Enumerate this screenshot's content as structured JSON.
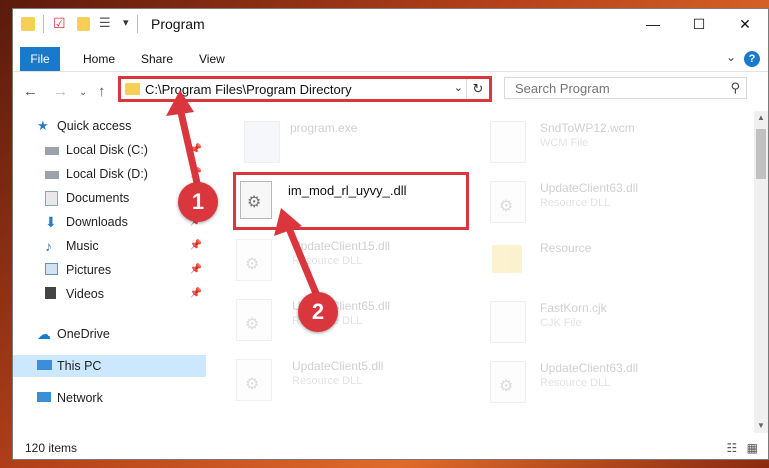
{
  "window": {
    "title": "Program"
  },
  "ribbon": {
    "tabs": [
      "File",
      "Home",
      "Share",
      "View"
    ],
    "help_label": "?"
  },
  "address": {
    "path": "C:\\Program Files\\Program Directory",
    "dropdown": "⌄",
    "refresh": "↻"
  },
  "search": {
    "placeholder": "Search Program",
    "icon": "search-icon"
  },
  "sidebar": {
    "items": [
      {
        "label": "Quick access",
        "icon": "star-icon",
        "pinned": false
      },
      {
        "label": "Local Disk (C:)",
        "icon": "disk-icon",
        "pinned": true
      },
      {
        "label": "Local Disk (D:)",
        "icon": "disk-icon",
        "pinned": true
      },
      {
        "label": "Documents",
        "icon": "documents-icon",
        "pinned": true
      },
      {
        "label": "Downloads",
        "icon": "download-icon",
        "pinned": true
      },
      {
        "label": "Music",
        "icon": "music-icon",
        "pinned": true
      },
      {
        "label": "Pictures",
        "icon": "pictures-icon",
        "pinned": true
      },
      {
        "label": "Videos",
        "icon": "videos-icon",
        "pinned": true
      },
      {
        "label": "OneDrive",
        "icon": "cloud-icon",
        "pinned": false
      },
      {
        "label": "This PC",
        "icon": "pc-icon",
        "pinned": false
      },
      {
        "label": "Network",
        "icon": "network-icon",
        "pinned": false
      }
    ]
  },
  "files": {
    "highlighted": {
      "name": "im_mod_rl_uyvy_.dll",
      "type": ""
    },
    "items": [
      {
        "name": "program.exe",
        "type": ""
      },
      {
        "name": "SndToWP12.wcm",
        "type": "WCM File"
      },
      {
        "name": "UpdateClient63.dll",
        "type": "Resource DLL"
      },
      {
        "name": "UpdateClient15.dll",
        "type": "Resource DLL"
      },
      {
        "name": "Resource",
        "type": ""
      },
      {
        "name": "UpdateClient65.dll",
        "type": "Resource DLL"
      },
      {
        "name": "FastKorn.cjk",
        "type": "CJK File"
      },
      {
        "name": "UpdateClient5.dll",
        "type": "Resource DLL"
      },
      {
        "name": "UpdateClient63.dll",
        "type": "Resource DLL"
      }
    ]
  },
  "status": {
    "item_count": "120 items"
  },
  "annotations": {
    "step1": "1",
    "step2": "2",
    "color": "#d9363e"
  }
}
